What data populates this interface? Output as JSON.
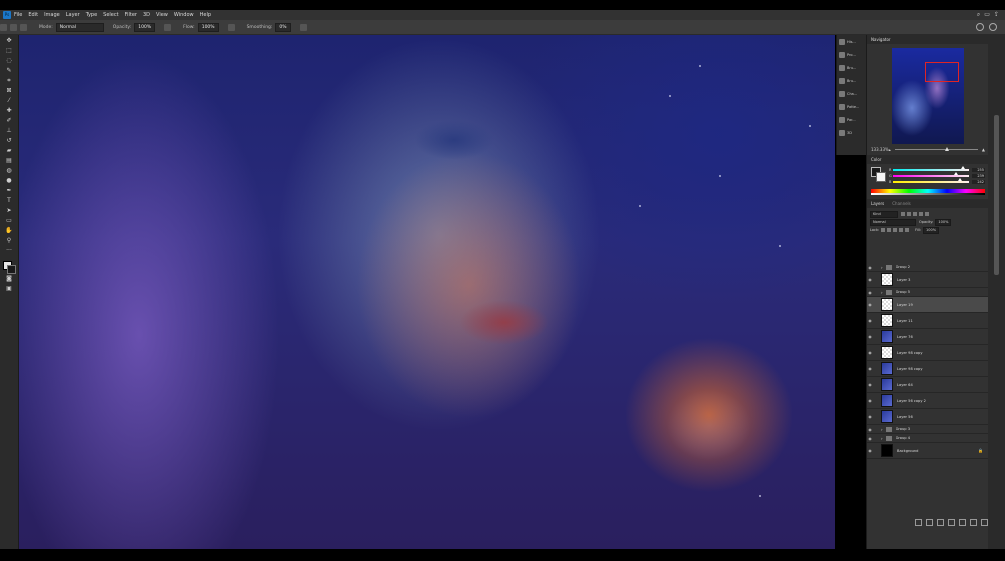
{
  "menu": {
    "items": [
      "File",
      "Edit",
      "Image",
      "Layer",
      "Type",
      "Select",
      "Filter",
      "3D",
      "View",
      "Window",
      "Help"
    ]
  },
  "options": {
    "mode_label": "Mode:",
    "mode_value": "Normal",
    "opacity_label": "Opacity:",
    "opacity_value": "100%",
    "flow_label": "Flow:",
    "flow_value": "100%",
    "smoothing_label": "Smoothing:",
    "smoothing_value": "0%"
  },
  "collapsed_panels": [
    "His...",
    "Pro...",
    "Bru...",
    "Bru...",
    "Cha...",
    "Patte...",
    "Par...",
    "3D"
  ],
  "navigator": {
    "tab": "Navigator",
    "zoom": "133.33%"
  },
  "color": {
    "tab": "Color",
    "r": "255",
    "g": "239",
    "b": "242",
    "r_frac": 0.9,
    "g_frac": 0.8,
    "b_frac": 0.85
  },
  "layers": {
    "tabs": [
      "Layers",
      "Channels"
    ],
    "filter_kind": "Kind",
    "blend_mode": "Normal",
    "opacity_label": "Opacity:",
    "opacity_value": "100%",
    "lock_label": "Lock:",
    "fill_label": "Fill:",
    "fill_value": "100%",
    "items": [
      {
        "name": "Group 2",
        "type": "group"
      },
      {
        "name": "Layer 3",
        "type": "layer",
        "thumb": "checker"
      },
      {
        "name": "Group 5",
        "type": "group"
      },
      {
        "name": "Layer 19",
        "type": "layer",
        "thumb": "checker",
        "selected": true
      },
      {
        "name": "Layer 11",
        "type": "layer",
        "thumb": "checker"
      },
      {
        "name": "Layer 76",
        "type": "layer",
        "thumb": "blue"
      },
      {
        "name": "Layer 98 copy",
        "type": "layer",
        "thumb": "checker"
      },
      {
        "name": "Layer 98 copy",
        "type": "layer",
        "thumb": "blue"
      },
      {
        "name": "Layer 64",
        "type": "layer",
        "thumb": "blue"
      },
      {
        "name": "Layer 56 copy 2",
        "type": "layer",
        "thumb": "blue"
      },
      {
        "name": "Layer 56",
        "type": "layer",
        "thumb": "blue"
      },
      {
        "name": "Group 3",
        "type": "group"
      },
      {
        "name": "Group 4",
        "type": "group"
      },
      {
        "name": "Background",
        "type": "layer",
        "thumb": "black",
        "locked": true
      }
    ]
  }
}
